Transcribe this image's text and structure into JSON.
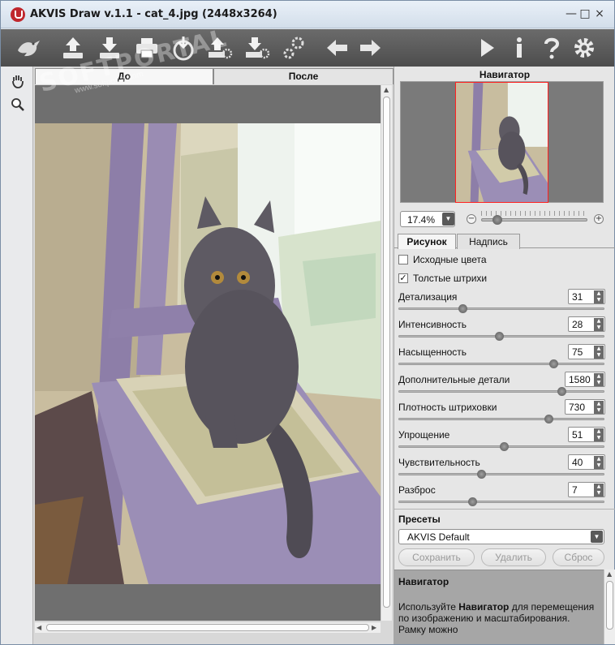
{
  "window": {
    "title": "AKVIS Draw v.1.1 - cat_4.jpg (2448x3264)",
    "minimize": "—",
    "maximize": "□",
    "close": "×"
  },
  "toolbar": {
    "icons": [
      "akvis-bird-logo-icon",
      "open-icon",
      "save-icon",
      "print-icon",
      "share-icon",
      "export-batch-icon",
      "import-batch-icon",
      "plugin-settings-icon",
      "undo-arrow-icon",
      "redo-arrow-icon",
      "run-icon",
      "info-icon",
      "help-icon",
      "preferences-gear-icon"
    ]
  },
  "watermark": {
    "text": "SOFTPORTAL",
    "sub": "www.softportal.com"
  },
  "view_tabs": {
    "before": "До",
    "after": "После"
  },
  "navigator": {
    "title": "Навигатор",
    "zoom": "17.4%",
    "zoom_level": 0.15
  },
  "params_tabs": {
    "drawing": "Рисунок",
    "caption": "Надпись"
  },
  "checkboxes": [
    {
      "label": "Исходные цвета",
      "checked": false
    },
    {
      "label": "Толстые штрихи",
      "checked": true
    }
  ],
  "params": [
    {
      "label": "Детализация",
      "value": "31",
      "level": 0.31
    },
    {
      "label": "Интенсивность",
      "value": "28",
      "level": 0.49
    },
    {
      "label": "Насыщенность",
      "value": "75",
      "level": 0.75
    },
    {
      "label": "Дополнительные детали",
      "value": "1580",
      "level": 0.79
    },
    {
      "label": "Плотность штриховки",
      "value": "730",
      "level": 0.73
    },
    {
      "label": "Упрощение",
      "value": "51",
      "level": 0.51
    },
    {
      "label": "Чувствительность",
      "value": "40",
      "level": 0.4
    },
    {
      "label": "Разброс",
      "value": "7",
      "level": 0.36
    }
  ],
  "presets": {
    "title": "Пресеты",
    "selected": "AKVIS Default",
    "save": "Сохранить",
    "delete": "Удалить",
    "reset": "Сброс"
  },
  "help": {
    "title": "Навигатор",
    "text_prefix": "Используйте ",
    "text_bold": "Навигатор",
    "text_suffix": " для перемещения по изображению и масштабирования. Рамку можно"
  }
}
